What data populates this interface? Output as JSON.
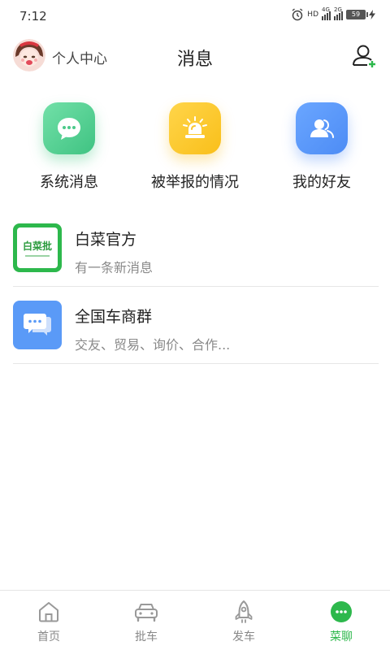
{
  "status_bar": {
    "time": "7:12",
    "network_1": "4G",
    "network_2": "2G",
    "hd": "HD",
    "battery": "59"
  },
  "header": {
    "profile_label": "个人中心",
    "title": "消息"
  },
  "categories": [
    {
      "label": "系统消息",
      "icon": "chat-bubble-icon",
      "color": "#4cc98a"
    },
    {
      "label": "被举报的情况",
      "icon": "alarm-light-icon",
      "color": "#fbc52a"
    },
    {
      "label": "我的好友",
      "icon": "friends-icon",
      "color": "#5a98f8"
    }
  ],
  "conversations": [
    {
      "name": "白菜官方",
      "preview": "有一条新消息",
      "thumb_text": "白菜批"
    },
    {
      "name": "全国车商群",
      "preview": "交友、贸易、询价、合作..."
    }
  ],
  "bottom_nav": [
    {
      "label": "首页",
      "icon": "home-icon",
      "active": false
    },
    {
      "label": "批车",
      "icon": "car-icon",
      "active": false
    },
    {
      "label": "发车",
      "icon": "rocket-icon",
      "active": false
    },
    {
      "label": "菜聊",
      "icon": "chat-icon",
      "active": true
    }
  ],
  "colors": {
    "accent_green": "#2db84c",
    "inactive_gray": "#888888"
  }
}
